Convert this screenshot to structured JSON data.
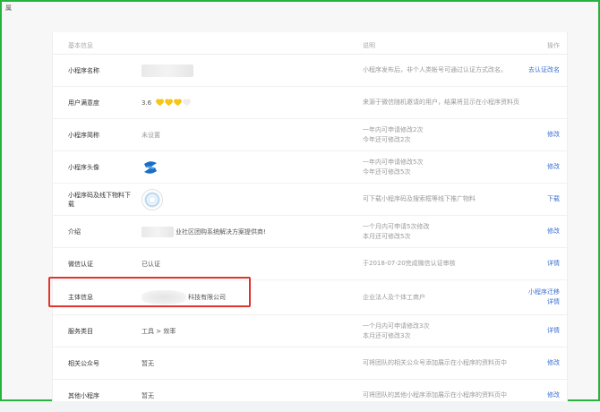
{
  "corner": {
    "label": "属"
  },
  "header": {
    "col_basic": "基本信息",
    "col_desc": "说明",
    "col_action": "操作"
  },
  "rows": [
    {
      "label": "小程序名称",
      "value": "",
      "desc1": "小程序发布后，非个人类帐号可通过认证方式改名。",
      "desc2": "",
      "action1": "去认证改名",
      "action2": ""
    },
    {
      "label": "用户满意度",
      "value": "3.6",
      "desc1": "来源于微信随机邀请的用户，结果将显示在小程序资料页",
      "desc2": "",
      "action1": "",
      "action2": ""
    },
    {
      "label": "小程序简称",
      "value": "未设置",
      "desc1": "一年内可申请修改2次",
      "desc2": "今年还可修改2次",
      "action1": "修改",
      "action2": ""
    },
    {
      "label": "小程序头像",
      "value": "",
      "desc1": "一年内可申请修改5次",
      "desc2": "今年还可修改5次",
      "action1": "修改",
      "action2": ""
    },
    {
      "label": "小程序码及线下物料下载",
      "value": "",
      "desc1": "可下载小程序码及搜索框等线下推广物料",
      "desc2": "",
      "action1": "下载",
      "action2": ""
    },
    {
      "label": "介绍",
      "value": "业社区团购系统解决方案提供商!",
      "desc1": "一个月内可申请5次修改",
      "desc2": "本月还可修改5次",
      "action1": "修改",
      "action2": ""
    },
    {
      "label": "微信认证",
      "value": "已认证",
      "desc1": "于2018-07-20完成微信认证审核",
      "desc2": "",
      "action1": "详情",
      "action2": ""
    },
    {
      "label": "主体信息",
      "value": "科技有限公司",
      "desc1": "企业法人及个体工商户",
      "desc2": "",
      "action1": "小程序迁移",
      "action2": "详情"
    },
    {
      "label": "服务类目",
      "value": "工具 > 效率",
      "desc1": "一个月内可申请修改3次",
      "desc2": "本月还可修改3次",
      "action1": "详情",
      "action2": ""
    },
    {
      "label": "相关公众号",
      "value": "暂无",
      "desc1": "可将团队的相关公众号添加展示在小程序的资料页中",
      "desc2": "",
      "action1": "修改",
      "action2": ""
    },
    {
      "label": "其他小程序",
      "value": "暂无",
      "desc1": "可将团队的其他小程序添加展示在小程序的资料页中",
      "desc2": "",
      "action1": "修改",
      "action2": ""
    }
  ],
  "colors": {
    "accent": "#3d6fd1",
    "highlight": "#e0342e",
    "frame": "#27b33d",
    "heart": "#f5c518"
  }
}
